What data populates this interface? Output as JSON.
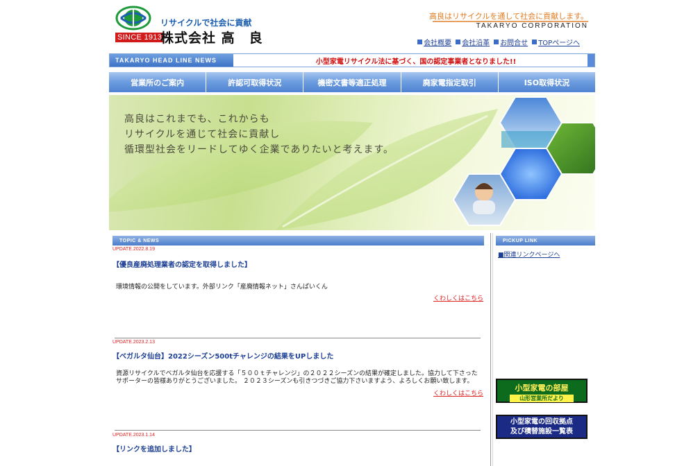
{
  "header": {
    "since": "SINCE 1913",
    "tagline": "リサイクルで社会に貢献",
    "company": "株式会社 高　良",
    "slogan": "高良はリサイクルを通して社会に貢献します。",
    "corp_en": "TAKARYO CORPORATION",
    "links": [
      "会社概要",
      "会社沿革",
      "お問合せ",
      "TOPページへ"
    ]
  },
  "newsbar": {
    "label": "TAKARYO HEAD LINE NEWS",
    "text": "小型家電リサイクル法に基づく、国の認定事業者となりました!!"
  },
  "nav": [
    "営業所のご案内",
    "許認可取得状況",
    "機密文書等適正処理",
    "廃家電指定取引",
    "ISO取得状況"
  ],
  "hero": {
    "lines": [
      "高良はこれまでも、これからも",
      "リサイクルを通じて社会に貢献し",
      "循環型社会をリードしてゆく企業でありたいと考えます。"
    ]
  },
  "topics": {
    "header": "TOPIC & NEWS",
    "items": [
      {
        "date": "UPDATE.2022.8.19",
        "title": "【優良産廃処理業者の認定を取得しました】",
        "body": "環境情報の公開をしています。外部リンク「産廃情報ネット」さんぱいくん",
        "more": "くわしくはこちら"
      },
      {
        "date": "UPDATE.2023.2.13",
        "title": "【ベガルタ仙台】2022シーズン500tチャレンジの結果をUPしました",
        "body": "資源リサイクルでベガルタ仙台を応援する「５００ｔチャレンジ」の２０２２シーズンの結果が確定しました。協力して下さったサポーターの皆様ありがとうございました。 ２０２３シーズンも引きつづきご協力下さいますよう、よろしくお願い致します。",
        "more": "くわしくはこちら"
      },
      {
        "date": "UPDATE.2023.1.14",
        "title": "【リンクを追加しました】"
      }
    ]
  },
  "pickup": {
    "header": "PICKUP LINK",
    "link": "■関連リンクページへ",
    "banner1": {
      "line1": "小型家電の部屋",
      "line2": "山形営業所だより"
    },
    "banner2": {
      "line1": "小型家電の回収拠点",
      "line2": "及び積替施設一覧表"
    }
  },
  "colors": {
    "accent_blue": "#4f83d2",
    "news_red": "#d01010",
    "slogan_orange": "#e47a1e",
    "banner_green": "#0d6b1e",
    "banner_navy": "#1b2a85"
  },
  "icons": [
    "takaryo-logo-icon",
    "square-bullet-icon"
  ]
}
